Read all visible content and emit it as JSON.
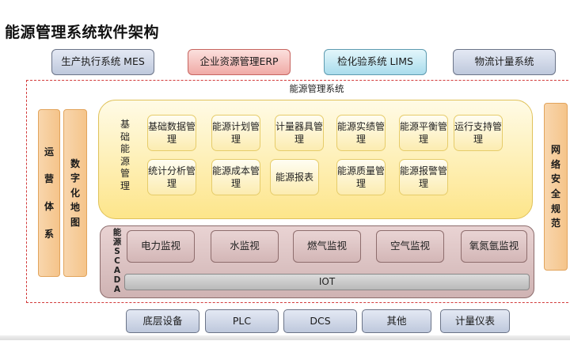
{
  "title": "能源管理系统软件架构",
  "top_systems": {
    "mes": "生产执行系统 MES",
    "erp": "企业资源管理ERP",
    "lims": "检化验系统 LIMS",
    "logistics": "物流计量系统"
  },
  "frame_label": "能源管理系统",
  "side": {
    "ops": [
      "运",
      "营",
      "体",
      "系"
    ],
    "map": [
      "数",
      "字",
      "化",
      "地",
      "图"
    ],
    "security": [
      "网",
      "络",
      "安",
      "全",
      "规",
      "范"
    ]
  },
  "energy": {
    "label_chars": [
      "基",
      "础",
      "能",
      "源",
      "管",
      "理"
    ],
    "modules": [
      "基础数据管理",
      "能源计划管理",
      "计量器具管理",
      "能源实绩管理",
      "能源平衡管理",
      "运行支持管理",
      "统计分析管理",
      "能源成本管理",
      "能源报表",
      "能源质量管理",
      "能源报警管理"
    ]
  },
  "scada": {
    "label_chars": [
      "能",
      "源",
      "S",
      "C",
      "A",
      "D",
      "A"
    ],
    "monitors": [
      "电力监视",
      "水监视",
      "燃气监视",
      "空气监视",
      "氧氮氩监视"
    ],
    "iot": "IOT"
  },
  "devices": [
    "底层设备",
    "PLC",
    "DCS",
    "其他",
    "计量仪表"
  ],
  "colors": {
    "frame": "#d23c3c",
    "energy_panel": "#fde58a",
    "side_bars": "#f5c48a",
    "scada_panel": "#cfb3b3"
  }
}
